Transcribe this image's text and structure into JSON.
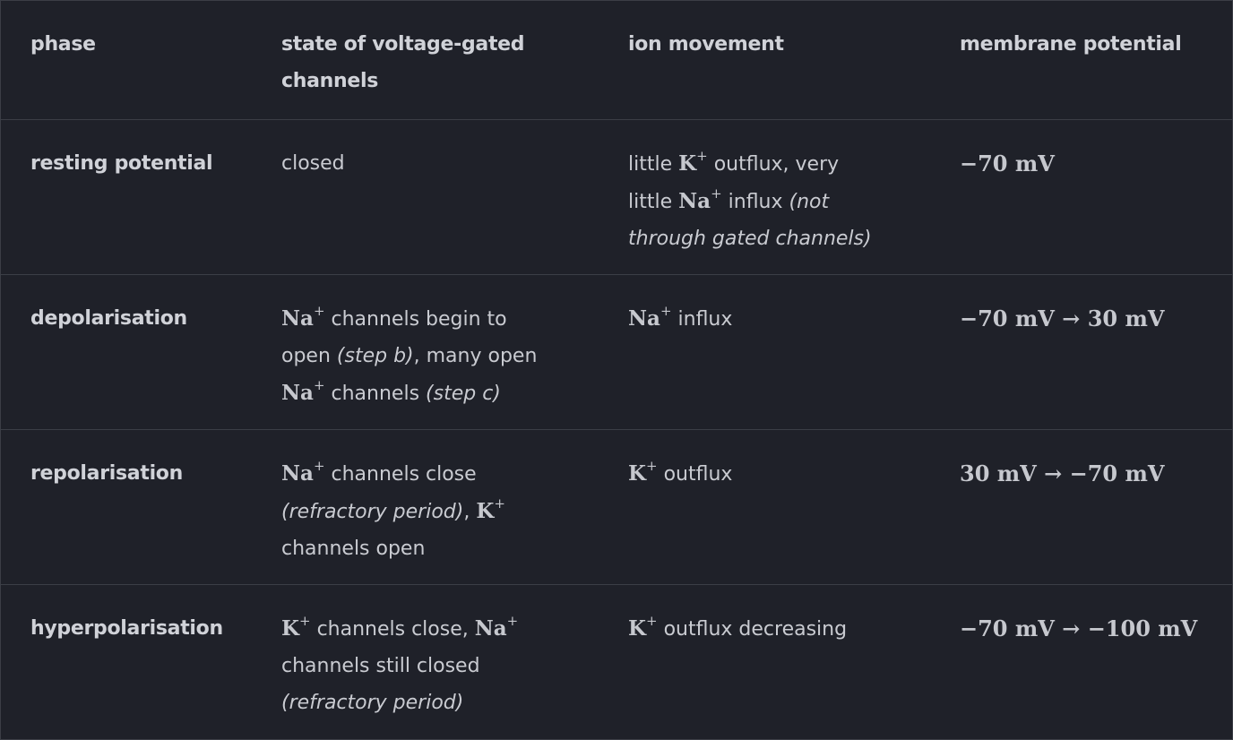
{
  "headers": [
    "phase",
    "state of voltage-gated channels",
    "ion movement",
    "membrane potential"
  ],
  "header_lines": {
    "state": [
      "state of voltage-gated",
      "channels"
    ]
  },
  "ions": {
    "na": "Na",
    "k": "K",
    "plus": "+"
  },
  "rows": [
    {
      "phase": "resting potential",
      "state": {
        "t1": "closed"
      },
      "ion": {
        "t1": "little ",
        "t2": " outflux, very",
        "t3": "little ",
        "t4": " influx ",
        "t5": "(not",
        "t6": "through gated channels)"
      },
      "potential": "−70 mV"
    },
    {
      "phase": "depolarisation",
      "state": {
        "t1": " channels begin to",
        "t2": "open ",
        "t3": "(step b)",
        "t4": ", many open",
        "t5": " channels ",
        "t6": "(step c)"
      },
      "ion": {
        "t1": " influx"
      },
      "potential": "−70 mV → 30 mV"
    },
    {
      "phase": "repolarisation",
      "state": {
        "t1": " channels close",
        "t2": "(refractory period)",
        "t3": ", ",
        "t4": "channels open"
      },
      "ion": {
        "t1": " outflux"
      },
      "potential": "30 mV → −70 mV"
    },
    {
      "phase": "hyperpolarisation",
      "state": {
        "t1": " channels close, ",
        "t2": "channels still closed",
        "t3": "(refractory period)"
      },
      "ion": {
        "t1": " outflux decreasing"
      },
      "potential": "−70 mV → −100 mV"
    }
  ]
}
